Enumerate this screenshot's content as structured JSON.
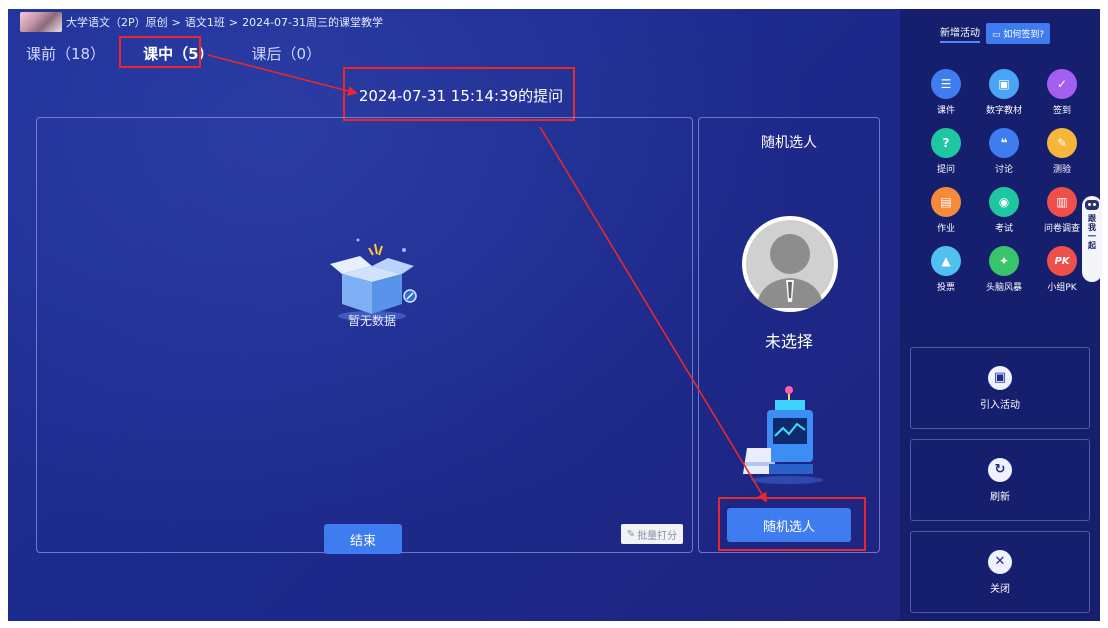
{
  "breadcrumb": {
    "course": "大学语文（2P）原创",
    "separator": ">",
    "class_name": "语文1班",
    "session": "2024-07-31周三的课堂教学"
  },
  "tabs": [
    {
      "label": "课前（18）",
      "active": false
    },
    {
      "label": "课中（5）",
      "active": true
    },
    {
      "label": "课后（0）",
      "active": false
    }
  ],
  "question_title": "2024-07-31 15:14:39的提问",
  "main_panel": {
    "empty_text": "暂无数据",
    "end_button": "结束",
    "batch_score_button": "批量打分",
    "batch_score_icon": "edit-icon"
  },
  "picker": {
    "title": "随机选人",
    "status": "未选择",
    "button": "随机选人"
  },
  "sidebar": {
    "header_label": "新增活动",
    "help_button": "如何签到?",
    "activities": [
      {
        "label": "课件",
        "icon": "courseware-icon",
        "color": "#3f7cf0",
        "glyph": "☰"
      },
      {
        "label": "数字教材",
        "icon": "digital-textbook-icon",
        "color": "#4aa6f5",
        "glyph": "▣"
      },
      {
        "label": "签到",
        "icon": "signin-icon",
        "color": "#a35ff0",
        "glyph": "✓"
      },
      {
        "label": "提问",
        "icon": "question-icon",
        "color": "#1fc7a0",
        "glyph": "?"
      },
      {
        "label": "讨论",
        "icon": "discussion-icon",
        "color": "#3f7cf0",
        "glyph": "❝"
      },
      {
        "label": "测验",
        "icon": "quiz-icon",
        "color": "#f5b63a",
        "glyph": "✎"
      },
      {
        "label": "作业",
        "icon": "homework-icon",
        "color": "#f58a3a",
        "glyph": "▤"
      },
      {
        "label": "考试",
        "icon": "exam-icon",
        "color": "#1fc7a0",
        "glyph": "◉"
      },
      {
        "label": "问卷调查",
        "icon": "survey-icon",
        "color": "#f0504a",
        "glyph": "▥"
      },
      {
        "label": "投票",
        "icon": "vote-icon",
        "color": "#4fc0f0",
        "glyph": "▲"
      },
      {
        "label": "头脑风暴",
        "icon": "brainstorm-icon",
        "color": "#38c46a",
        "glyph": "✦"
      },
      {
        "label": "小组PK",
        "icon": "group-pk-icon",
        "color": "#f0504a",
        "glyph": "PK"
      }
    ],
    "import_activity": "引入活动",
    "refresh": "刷新",
    "close": "关闭"
  },
  "robot_helper": "跟我一起"
}
